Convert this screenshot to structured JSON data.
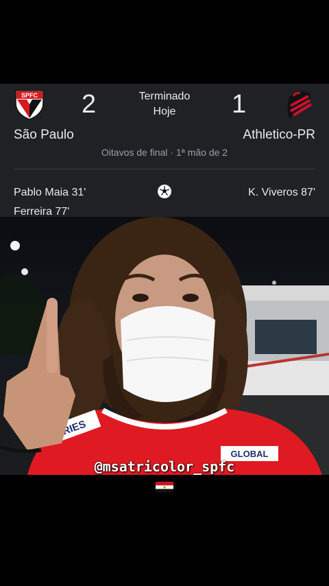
{
  "match": {
    "status": "Terminado",
    "date": "Hoje",
    "round": "Oitavos de final · 1ª mão de 2",
    "home": {
      "name": "São Paulo",
      "crest_text": "SPFC",
      "score": "2",
      "scorers": [
        "Pablo Maia 31'",
        "Ferreira 77'"
      ]
    },
    "away": {
      "name": "Athletico-PR",
      "score": "1",
      "scorers": [
        "K. Viveros 87'"
      ]
    }
  },
  "video": {
    "watermark": "@msatricolor_spfc",
    "jersey_sponsor_left": "FRIES",
    "jersey_sponsor_right": "GLOBAL"
  },
  "icons": {
    "goal": "soccer-ball-icon",
    "flag": "egypt-flag-icon"
  },
  "colors": {
    "card_background": "#202124",
    "text_primary": "#e8eaed",
    "text_secondary": "#9aa0a6",
    "spfc_red": "#d71920",
    "athletico_red": "#c8102e",
    "jersey_red": "#e01a22"
  }
}
